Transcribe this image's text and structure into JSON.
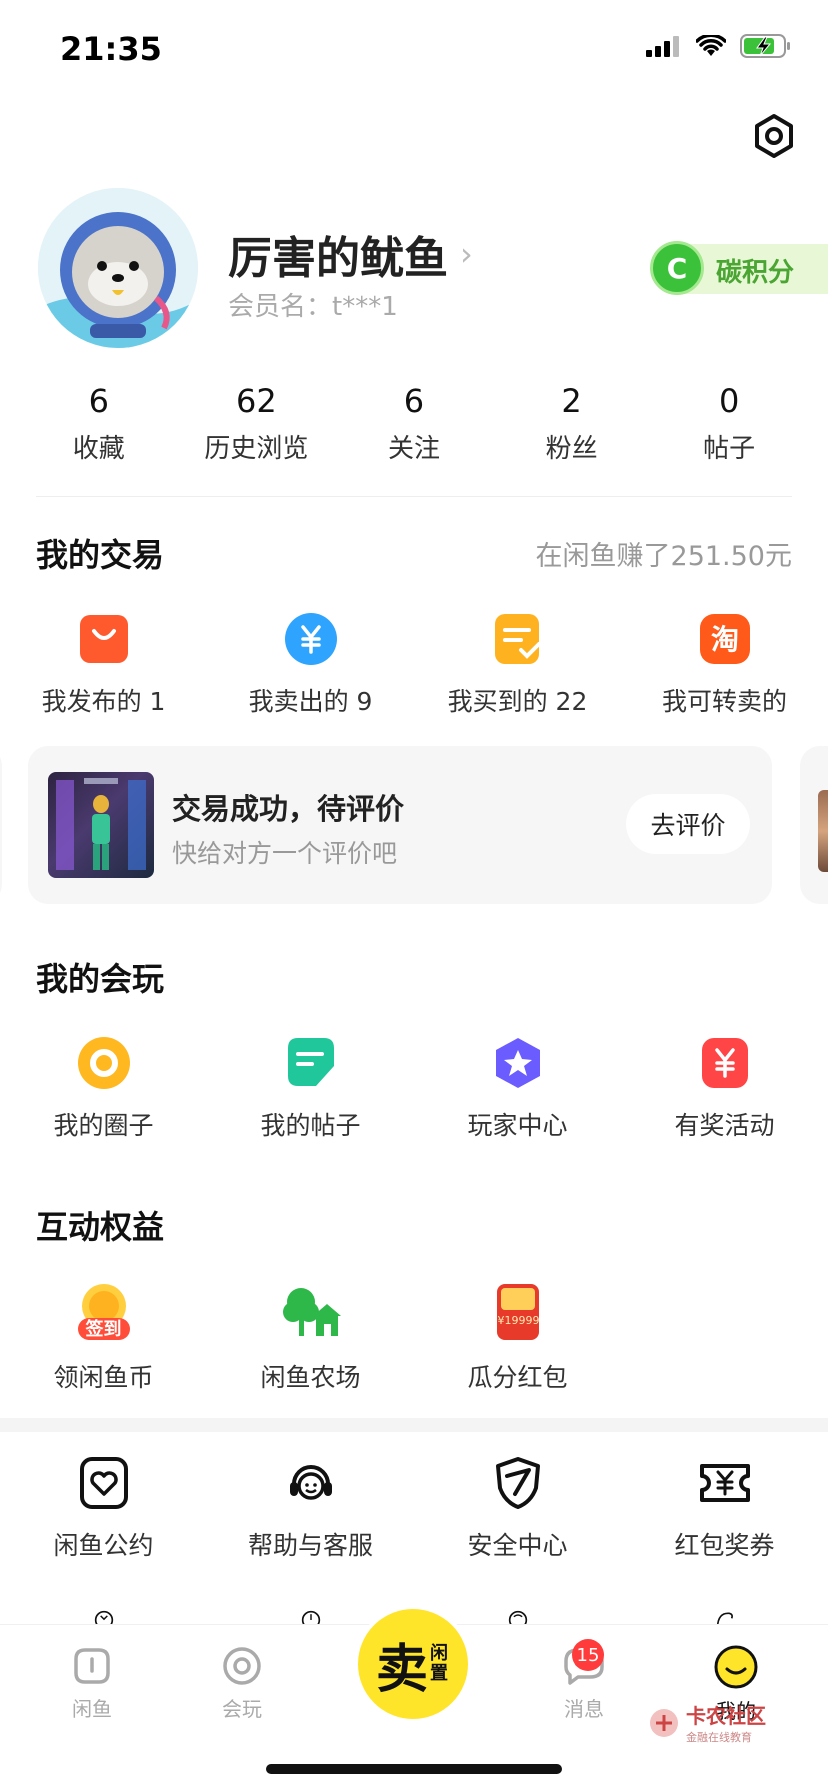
{
  "status_bar": {
    "time": "21:35"
  },
  "profile": {
    "name": "厉害的鱿鱼",
    "name_chevron": "›",
    "member_name": "会员名：t***1",
    "carbon_icon_letter": "C",
    "carbon_label": "碳积分"
  },
  "stats": [
    {
      "value": "6",
      "label": "收藏"
    },
    {
      "value": "62",
      "label": "历史浏览"
    },
    {
      "value": "6",
      "label": "关注"
    },
    {
      "value": "2",
      "label": "粉丝"
    },
    {
      "value": "0",
      "label": "帖子"
    }
  ],
  "my_trades": {
    "title": "我的交易",
    "earnings": "在闲鱼赚了251.50元",
    "items": [
      {
        "label": "我发布的 1",
        "icon": "bag-icon",
        "color": "#ff5a2e"
      },
      {
        "label": "我卖出的 9",
        "icon": "yuan-icon",
        "color": "#2ea4ff"
      },
      {
        "label": "我买到的 22",
        "icon": "order-check-icon",
        "color": "#ffb21f"
      },
      {
        "label": "我可转卖的",
        "icon": "taobao-icon",
        "color": "#ff5a1a"
      }
    ]
  },
  "trade_card": {
    "title": "交易成功，待评价",
    "subtitle": "快给对方一个评价吧",
    "button": "去评价"
  },
  "my_play": {
    "title": "我的会玩",
    "items": [
      {
        "label": "我的圈子",
        "icon": "circle-icon",
        "color": "#ffb81f"
      },
      {
        "label": "我的帖子",
        "icon": "post-icon",
        "color": "#1fc79a"
      },
      {
        "label": "玩家中心",
        "icon": "star-badge-icon",
        "color": "#6b5cff"
      },
      {
        "label": "有奖活动",
        "icon": "prize-yuan-icon",
        "color": "#ff4545"
      }
    ]
  },
  "benefits": {
    "title": "互动权益",
    "items": [
      {
        "label": "领闲鱼币",
        "icon": "sign-in-coin-icon",
        "badge": "签到"
      },
      {
        "label": "闲鱼农场",
        "icon": "farm-icon"
      },
      {
        "label": "瓜分红包",
        "icon": "red-envelope-icon",
        "amount": "¥19999"
      }
    ]
  },
  "services": [
    {
      "label": "闲鱼公约",
      "icon": "pact-heart-icon"
    },
    {
      "label": "帮助与客服",
      "icon": "customer-service-icon"
    },
    {
      "label": "安全中心",
      "icon": "shield-icon"
    },
    {
      "label": "红包奖券",
      "icon": "coupon-icon"
    }
  ],
  "bottom_nav": {
    "items": [
      {
        "label": "闲鱼",
        "icon": "home-icon"
      },
      {
        "label": "会玩",
        "icon": "play-icon"
      },
      {
        "label": "消息",
        "icon": "message-icon",
        "badge": "15"
      },
      {
        "label": "我的",
        "icon": "profile-smile-icon"
      }
    ],
    "sell_main": "卖",
    "sell_side": "闲置"
  },
  "watermark": {
    "title": "卡农社区",
    "subtitle": "金融在线教育"
  },
  "colors": {
    "brand_yellow": "#ffe52a",
    "accent_green": "#3cc23a"
  }
}
